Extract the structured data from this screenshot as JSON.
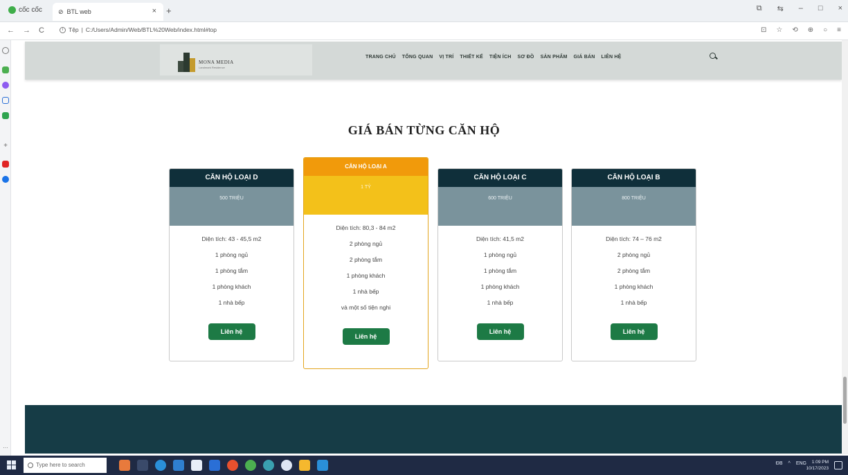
{
  "browser": {
    "brand": "cốc cốc",
    "tab_title": "BTL web",
    "tab_close": "×",
    "new_tab": "+",
    "url_prefix": "Tệp",
    "url": "C:/Users/Admin/Web/BTL%20Web/index.html#top",
    "win_controls": [
      "⧉",
      "⇆",
      "–",
      "□",
      "×"
    ],
    "nav": [
      "←",
      "→",
      "C"
    ],
    "addr_right": [
      "⊡",
      "☆",
      "⟲",
      "⊕",
      "○",
      "≡"
    ]
  },
  "site": {
    "logo_text": "MONA MEDIA",
    "logo_sub": "Landmark Residence",
    "menu": [
      "TRANG CHỦ",
      "TỔNG QUAN",
      "VỊ TRÍ",
      "THIẾT KẾ",
      "TIỆN ÍCH",
      "SƠ ĐỒ",
      "SẢN PHẨM",
      "GIÁ BÁN",
      "LIÊN HỆ"
    ],
    "section_title": "GIÁ BÁN TỪNG CĂN HỘ",
    "cards": [
      {
        "name": "CĂN HỘ LOẠI D",
        "price": "500 TRIỆU",
        "features": [
          "Diện tích: 43 - 45,5 m2",
          "1 phòng ngủ",
          "1 phòng tắm",
          "1 phòng khách",
          "1 nhà bếp"
        ],
        "button": "Liên hệ"
      },
      {
        "name": "CĂN HỘ LOẠI A",
        "price": "1 TỶ",
        "features": [
          "Diện tích: 80,3 - 84 m2",
          "2 phòng ngủ",
          "2 phòng tắm",
          "1 phòng khách",
          "1 nhà bếp",
          "và một số tiện nghi"
        ],
        "button": "Liên hệ"
      },
      {
        "name": "CĂN HỘ LOẠI C",
        "price": "600 TRIỆU",
        "features": [
          "Diện tích: 41,5 m2",
          "1 phòng ngủ",
          "1 phòng tắm",
          "1 phòng khách",
          "1 nhà bếp"
        ],
        "button": "Liên hệ"
      },
      {
        "name": "CĂN HỘ LOẠI B",
        "price": "800 TRIỆU",
        "features": [
          "Diện tích: 74 – 76 m2",
          "2 phòng ngủ",
          "2 phòng tắm",
          "1 phòng khách",
          "1 nhà bếp"
        ],
        "button": "Liên hệ"
      }
    ]
  },
  "taskbar": {
    "search_placeholder": "Type here to search",
    "tray_text": "ĐB",
    "language": "ENG",
    "time": "1:09 PM",
    "date": "10/17/2023"
  },
  "colors": {
    "card_header": "#0f2f3a",
    "card_price_bg": "#7a939c",
    "featured_header": "#f19a0b",
    "featured_price_bg": "#f3c11a",
    "button": "#1d7a45",
    "footer": "#163c46"
  }
}
